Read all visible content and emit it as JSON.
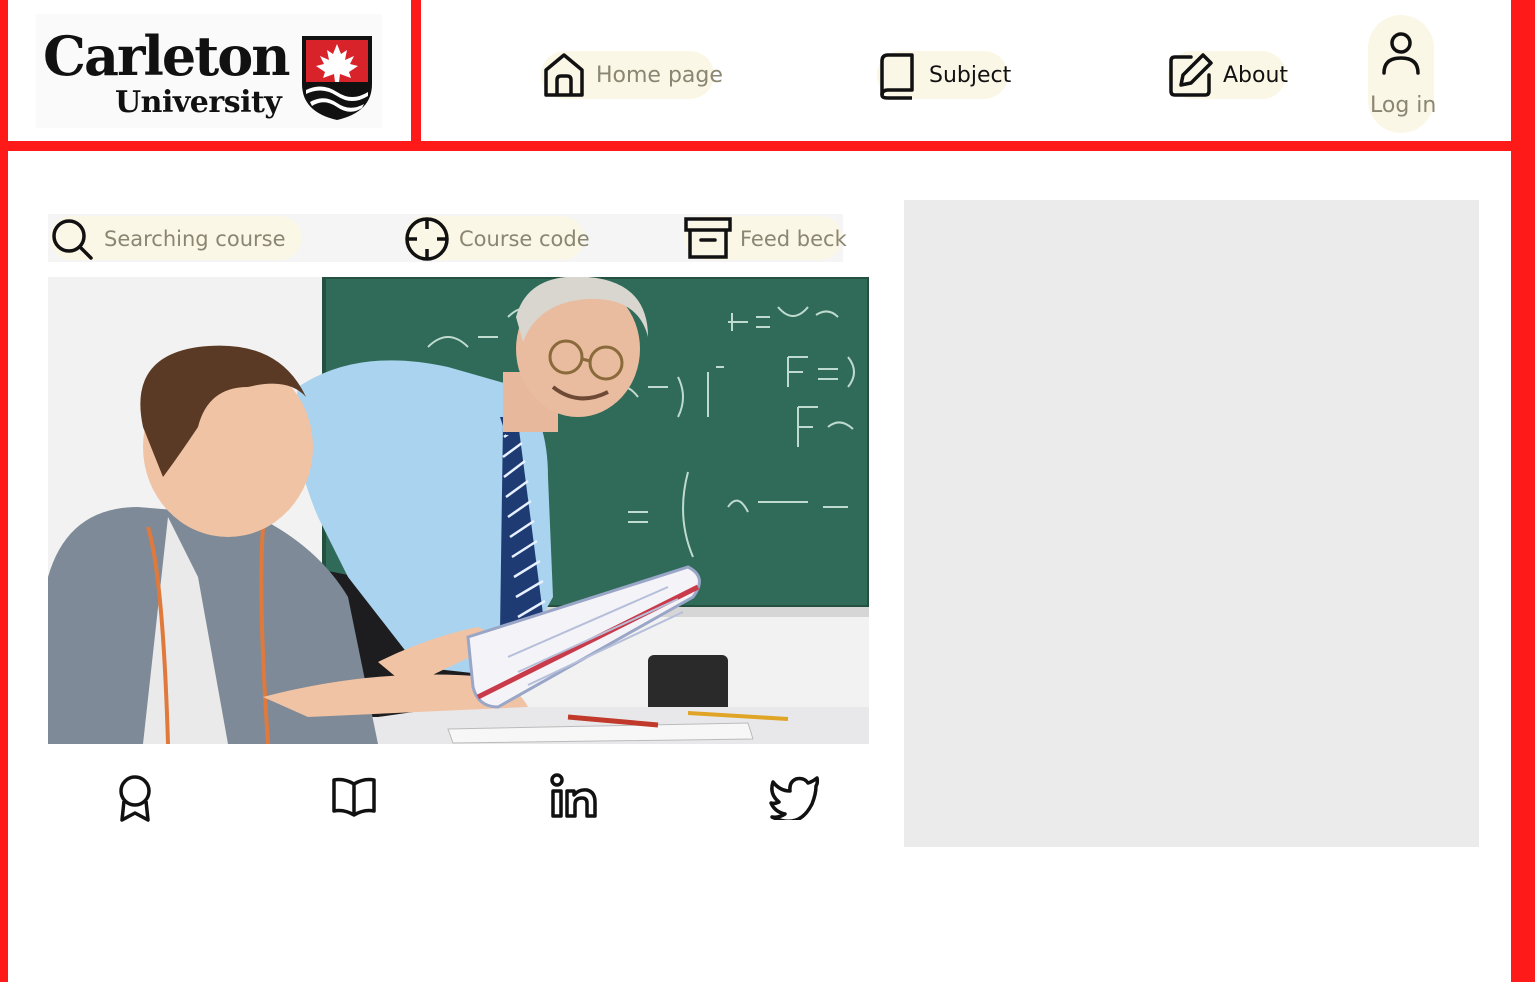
{
  "logo": {
    "line1": "Carleton",
    "line2": "University",
    "shield_icon": "maple-leaf-shield-icon"
  },
  "nav": {
    "home": {
      "label": "Home page",
      "icon": "home-icon"
    },
    "subject": {
      "label": "Subject",
      "icon": "book-icon"
    },
    "about": {
      "label": "About",
      "icon": "edit-icon"
    },
    "login": {
      "label": "Log in",
      "icon": "user-icon"
    }
  },
  "toolbar": {
    "search": {
      "label": "Searching course",
      "icon": "search-icon"
    },
    "course_code": {
      "label": "Course code",
      "icon": "crosshair-icon"
    },
    "feedback": {
      "label": "Feed beck",
      "icon": "archive-icon"
    }
  },
  "hero": {
    "icon": "classroom-photo"
  },
  "social": [
    "award-icon",
    "open-book-icon",
    "linkedin-icon",
    "twitter-icon"
  ],
  "colors": {
    "frame": "#ff1a1a",
    "pill": "#fbf7e6",
    "muted_text": "#8b8672",
    "panel": "#ebebeb",
    "brand_red": "#d8232a"
  }
}
